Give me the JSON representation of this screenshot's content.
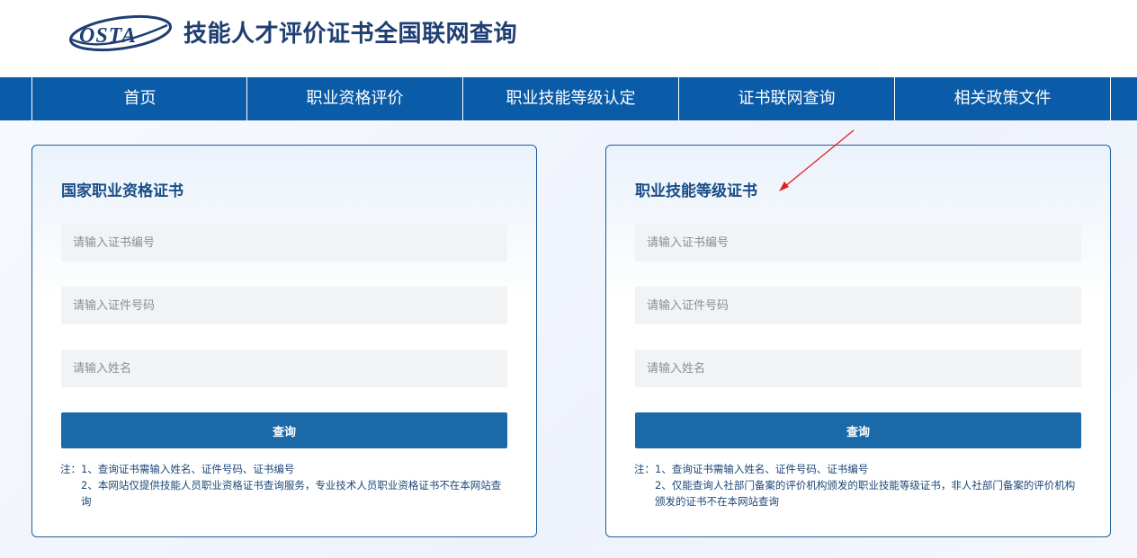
{
  "header": {
    "logo_text": "OSTA",
    "title": "技能人才评价证书全国联网查询"
  },
  "nav": {
    "items": [
      {
        "label": "首页"
      },
      {
        "label": "职业资格评价"
      },
      {
        "label": "职业技能等级认定"
      },
      {
        "label": "证书联网查询"
      },
      {
        "label": "相关政策文件"
      }
    ]
  },
  "cards": [
    {
      "title": "国家职业资格证书",
      "cert_no_placeholder": "请输入证书编号",
      "id_no_placeholder": "请输入证件号码",
      "name_placeholder": "请输入姓名",
      "button_label": "查询",
      "note_prefix": "注：",
      "note_1": "1、查询证书需输入姓名、证件号码、证书编号",
      "note_2": "2、本网站仅提供技能人员职业资格证书查询服务，专业技术人员职业资格证书不在本网站查询"
    },
    {
      "title": "职业技能等级证书",
      "cert_no_placeholder": "请输入证书编号",
      "id_no_placeholder": "请输入证件号码",
      "name_placeholder": "请输入姓名",
      "button_label": "查询",
      "note_prefix": "注：",
      "note_1": "1、查询证书需输入姓名、证件号码、证书编号",
      "note_2": "2、仅能查询人社部门备案的评价机构颁发的职业技能等级证书，非人社部门备案的评价机构颁发的证书不在本网站查询"
    }
  ],
  "colors": {
    "nav_bg": "#0a5ba8",
    "button_bg": "#1a69a8",
    "card_border": "#1f5e98",
    "title_color": "#1f3f73",
    "annotation_arrow": "#e02020"
  }
}
